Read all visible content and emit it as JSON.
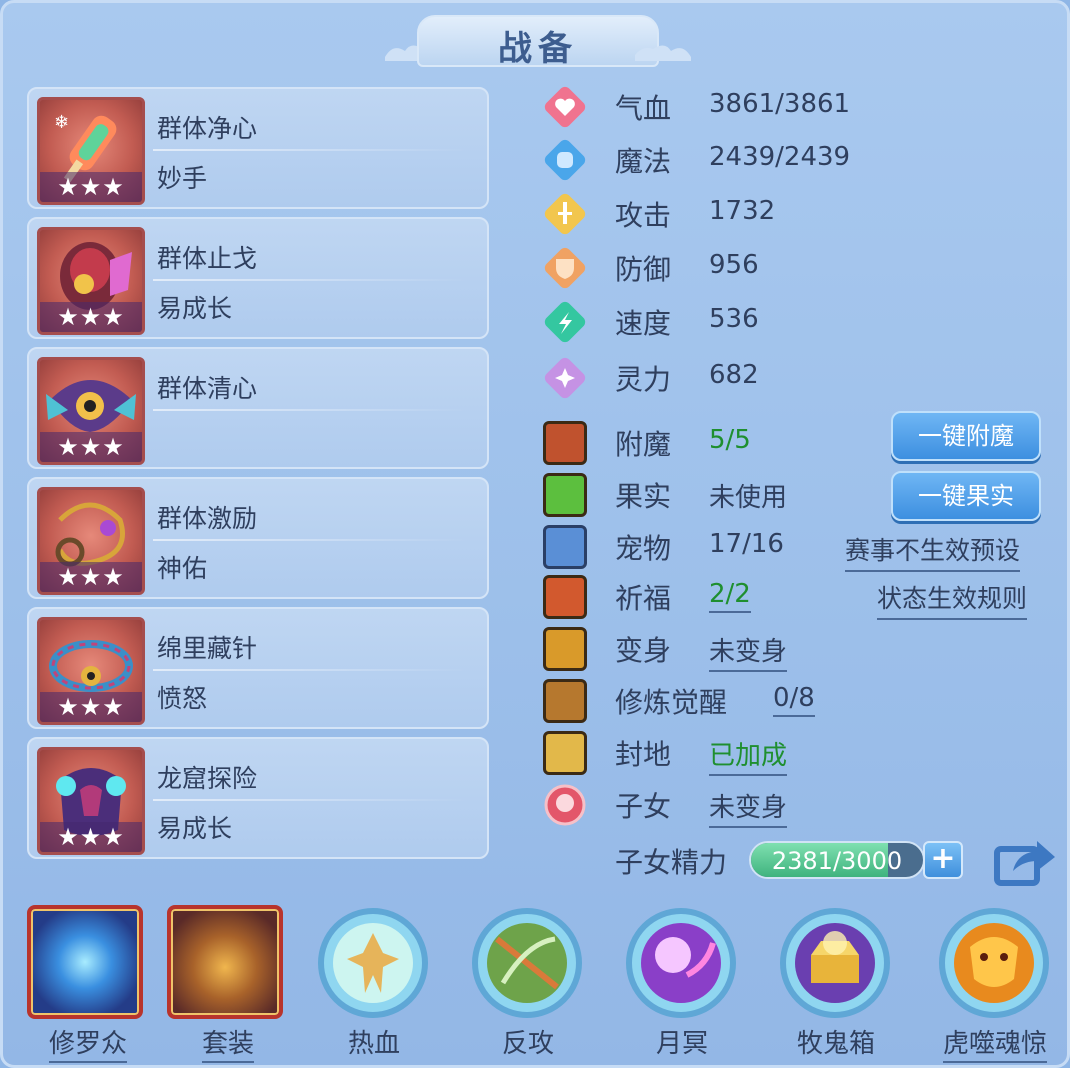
{
  "title": "战备",
  "skills": [
    {
      "name": "群体净心",
      "sub": "妙手",
      "stars": "★★★",
      "icon": "popsicle-icon"
    },
    {
      "name": "群体止戈",
      "sub": "易成长",
      "stars": "★★★",
      "icon": "bracer-icon"
    },
    {
      "name": "群体清心",
      "sub": "",
      "stars": "★★★",
      "icon": "eye-mask-icon"
    },
    {
      "name": "群体激励",
      "sub": "神佑",
      "stars": "★★★",
      "icon": "chain-icon"
    },
    {
      "name": "绵里藏针",
      "sub": "愤怒",
      "stars": "★★★",
      "icon": "ring-icon"
    },
    {
      "name": "龙窟探险",
      "sub": "易成长",
      "stars": "★★★",
      "icon": "dragon-armor-icon"
    }
  ],
  "stats": {
    "hp": {
      "label": "气血",
      "value": "3861/3861"
    },
    "mp": {
      "label": "魔法",
      "value": "2439/2439"
    },
    "atk": {
      "label": "攻击",
      "value": "1732"
    },
    "def": {
      "label": "防御",
      "value": "956"
    },
    "spd": {
      "label": "速度",
      "value": "536"
    },
    "spirit": {
      "label": "灵力",
      "value": "682"
    }
  },
  "status": {
    "enchant": {
      "label": "附魔",
      "value": "5/5"
    },
    "fruit": {
      "label": "果实",
      "value": "未使用"
    },
    "pet": {
      "label": "宠物",
      "value": "17/16"
    },
    "bless": {
      "label": "祈福",
      "value": "2/2"
    },
    "transform": {
      "label": "变身",
      "value": "未变身"
    },
    "awaken": {
      "label": "修炼觉醒",
      "value": "0/8"
    },
    "fief": {
      "label": "封地",
      "value": "已加成"
    },
    "child": {
      "label": "子女",
      "value": "未变身"
    },
    "child_energy": {
      "label": "子女精力",
      "value": "2381/3000",
      "current": 2381,
      "max": 3000
    }
  },
  "buttons": {
    "one_key_enchant": "一键附魔",
    "one_key_fruit": "一键果实",
    "match_preset": "赛事不生效预设",
    "state_rules": "状态生效规则",
    "plus": "+"
  },
  "bottom": [
    {
      "label": "修罗众",
      "icon": "blue-orb-icon"
    },
    {
      "label": "套装",
      "icon": "treasure-pot-icon"
    },
    {
      "label": "热血",
      "icon": "warrior-icon"
    },
    {
      "label": "反攻",
      "icon": "green-slash-icon"
    },
    {
      "label": "月冥",
      "icon": "purple-moon-icon"
    },
    {
      "label": "牧鬼箱",
      "icon": "gold-chest-icon"
    },
    {
      "label": "虎噬魂惊",
      "icon": "tiger-icon"
    }
  ],
  "colors": {
    "panel": "#9cbfea",
    "accent_green": "#1f8f2f",
    "text": "#2f3f5e",
    "button": "#3d8fe0"
  }
}
